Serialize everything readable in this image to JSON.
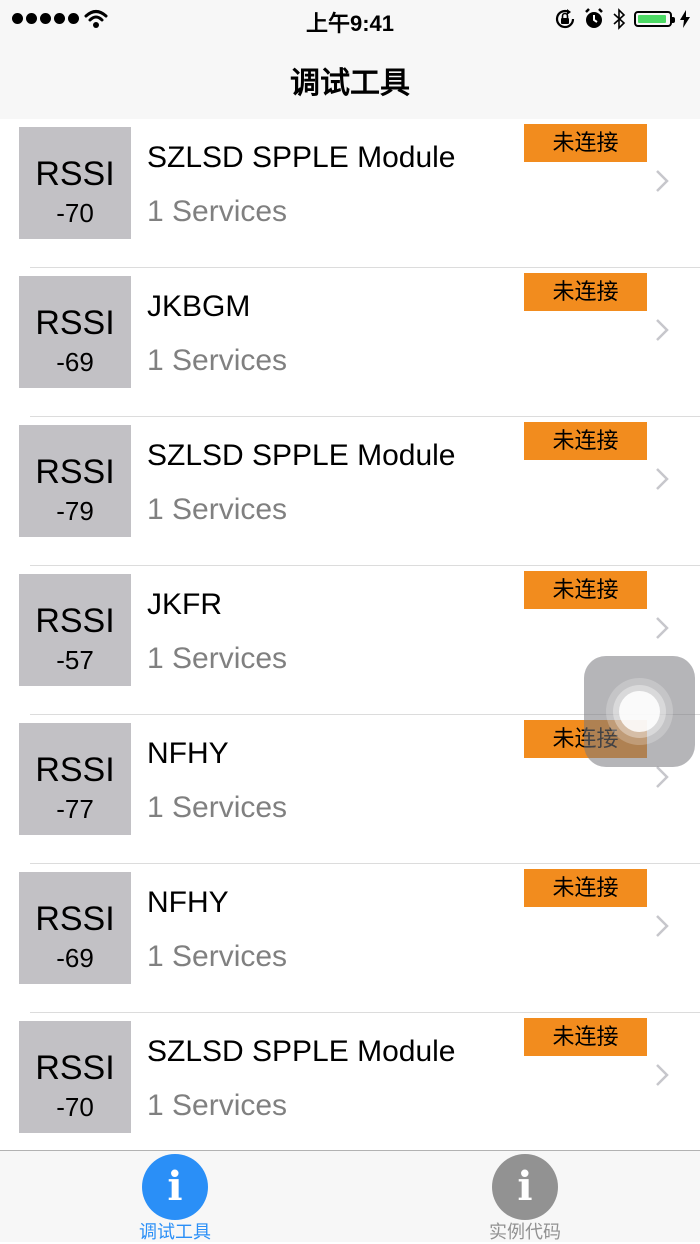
{
  "status_bar": {
    "time": "上午9:41",
    "battery_color": "#4cd964"
  },
  "nav": {
    "title": "调试工具"
  },
  "devices": [
    {
      "rssi_label": "RSSI",
      "rssi": "-70",
      "name": "SZLSD SPPLE Module",
      "services": "1 Services",
      "status": "未连接"
    },
    {
      "rssi_label": "RSSI",
      "rssi": "-69",
      "name": "JKBGM",
      "services": "1 Services",
      "status": "未连接"
    },
    {
      "rssi_label": "RSSI",
      "rssi": "-79",
      "name": "SZLSD SPPLE Module",
      "services": "1 Services",
      "status": "未连接"
    },
    {
      "rssi_label": "RSSI",
      "rssi": "-57",
      "name": "JKFR",
      "services": "1 Services",
      "status": "未连接"
    },
    {
      "rssi_label": "RSSI",
      "rssi": "-77",
      "name": "NFHY",
      "services": "1 Services",
      "status": "未连接"
    },
    {
      "rssi_label": "RSSI",
      "rssi": "-69",
      "name": "NFHY",
      "services": "1 Services",
      "status": "未连接"
    },
    {
      "rssi_label": "RSSI",
      "rssi": "-70",
      "name": "SZLSD SPPLE Module",
      "services": "1 Services",
      "status": "未连接"
    }
  ],
  "tabs": [
    {
      "label": "调试工具",
      "icon": "info-icon",
      "active": true,
      "color": "#2a8ff7"
    },
    {
      "label": "实例代码",
      "icon": "info-icon",
      "active": false,
      "color": "#929292"
    }
  ],
  "colors": {
    "badge": "#f28c1e",
    "rssi_box": "#c2c1c5",
    "accent": "#2a8ff7"
  }
}
